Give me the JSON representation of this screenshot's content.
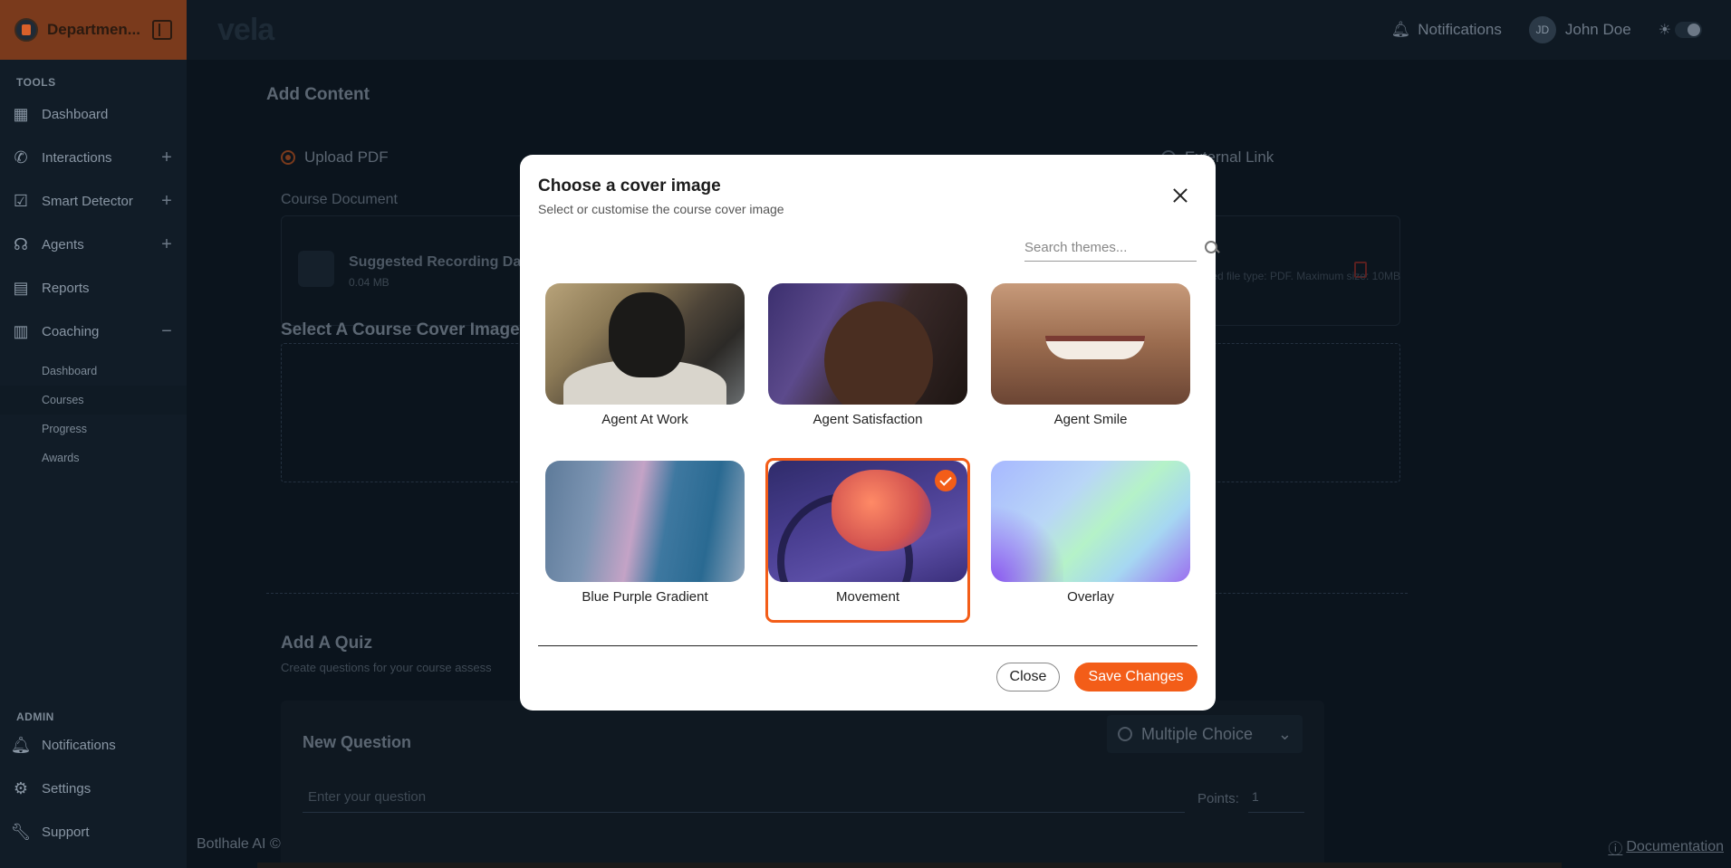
{
  "sidebar": {
    "department": "Departmen...",
    "tools_label": "TOOLS",
    "items": [
      {
        "label": "Dashboard",
        "icon": "grid-icon"
      },
      {
        "label": "Interactions",
        "icon": "phone-icon"
      },
      {
        "label": "Smart Detector",
        "icon": "check-box-icon"
      },
      {
        "label": "Agents",
        "icon": "headset-icon"
      },
      {
        "label": "Reports",
        "icon": "report-icon"
      },
      {
        "label": "Coaching",
        "icon": "books-icon"
      }
    ],
    "coaching_sub": [
      "Dashboard",
      "Courses",
      "Progress",
      "Awards"
    ],
    "admin_label": "ADMIN",
    "admin_items": [
      {
        "label": "Notifications",
        "icon": "bell-icon"
      },
      {
        "label": "Settings",
        "icon": "gear-icon"
      },
      {
        "label": "Support",
        "icon": "wrench-icon"
      }
    ]
  },
  "topbar": {
    "brand": "vela",
    "notifications": "Notifications",
    "user_initials": "JD",
    "user_name": "John Doe"
  },
  "main": {
    "title": "Add Content",
    "upload_pdf": "Upload PDF",
    "external_link": "External Link",
    "course_document": "Course Document",
    "doc_name": "Suggested Recording Da",
    "doc_size": "0.04 MB",
    "doc_note": "Accepted file type: PDF. Maximum size: 10MB",
    "cover_heading": "Select A Course Cover Image",
    "quiz_heading": "Add A Quiz",
    "quiz_sub": "Create questions for your course assess",
    "question_title": "New Question",
    "question_type": "Multiple Choice",
    "question_placeholder": "Enter your question",
    "points_label": "Points:",
    "points_value": "1"
  },
  "footer": {
    "left": "Botlhale AI ©",
    "right": "Documentation"
  },
  "modal": {
    "title": "Choose a cover image",
    "subtitle": "Select or customise the course cover image",
    "search_placeholder": "Search themes...",
    "images": [
      {
        "label": "Agent At Work",
        "selected": false
      },
      {
        "label": "Agent Satisfaction",
        "selected": false
      },
      {
        "label": "Agent Smile",
        "selected": false
      },
      {
        "label": "Blue Purple Gradient",
        "selected": false
      },
      {
        "label": "Movement",
        "selected": true
      },
      {
        "label": "Overlay",
        "selected": false
      }
    ],
    "close_label": "Close",
    "save_label": "Save Changes",
    "accent_color": "#f35d18"
  }
}
